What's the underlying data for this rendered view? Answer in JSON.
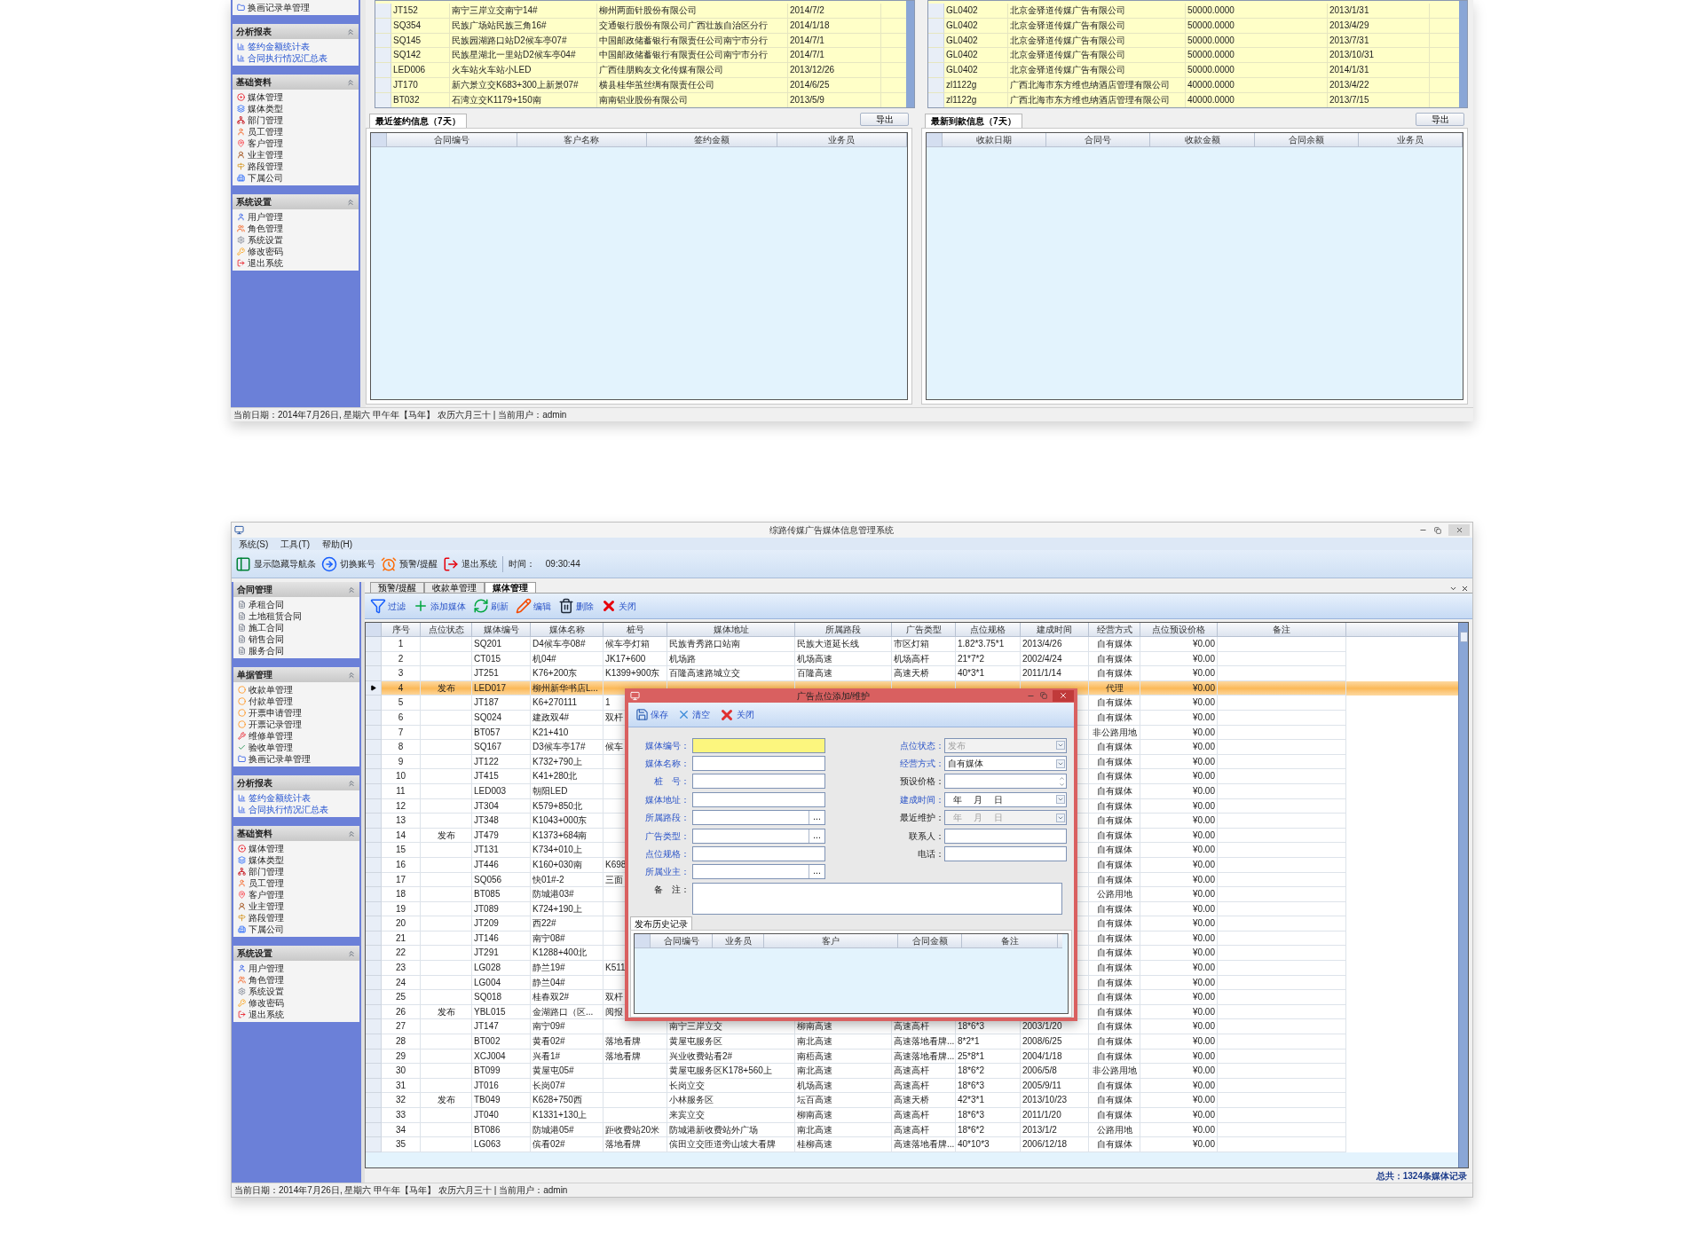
{
  "top_window": {
    "sidebar": [
      {
        "kind": "documents",
        "items": [
          {
            "label": "换画记录单管理"
          }
        ]
      },
      {
        "kind": "reports",
        "title": "分析报表",
        "items": [
          {
            "label": "签约金额统计表"
          },
          {
            "label": "合同执行情况汇总表"
          }
        ]
      },
      {
        "kind": "basics",
        "title": "基础资料",
        "items": [
          {
            "label": "媒体管理"
          },
          {
            "label": "媒体类型"
          },
          {
            "label": "部门管理"
          },
          {
            "label": "员工管理"
          },
          {
            "label": "客户管理"
          },
          {
            "label": "业主管理"
          },
          {
            "label": "路段管理"
          },
          {
            "label": "下属公司"
          }
        ]
      },
      {
        "kind": "settings",
        "title": "系统设置",
        "items": [
          {
            "label": "用户管理"
          },
          {
            "label": "角色管理"
          },
          {
            "label": "系统设置"
          },
          {
            "label": "修改密码"
          },
          {
            "label": "退出系统"
          }
        ]
      }
    ],
    "signed_list": {
      "rows": [
        [
          "JT152",
          "南宁三岸立交南宁14#",
          "柳州两面针股份有限公司",
          "2014/7/2"
        ],
        [
          "SQ354",
          "民族广场站民族三角16#",
          "交通银行股份有限公司广西壮族自治区分行",
          "2014/1/18"
        ],
        [
          "SQ145",
          "民族园湖路口站D2候车亭07#",
          "中国邮政储蓄银行有限责任公司南宁市分行",
          "2014/7/1"
        ],
        [
          "SQ142",
          "民族星湖北一里站D2候车亭04#",
          "中国邮政储蓄银行有限责任公司南宁市分行",
          "2014/7/1"
        ],
        [
          "LED006",
          "火车站火车站小LED",
          "广西佳朋购友文化传媒有限公司",
          "2013/12/26"
        ],
        [
          "JT170",
          "新六景立交K683+300上新景07#",
          "横县桂华茧丝绸有限责任公司",
          "2014/6/25"
        ],
        [
          "BT032",
          "石湾立交K1179+150南",
          "南南铝业股份有限公司",
          "2013/5/9"
        ]
      ]
    },
    "payment_list": {
      "rows": [
        [
          "GL0402",
          "北京金驿道传媒广告有限公司",
          "50000.0000",
          "2013/1/31"
        ],
        [
          "GL0402",
          "北京金驿道传媒广告有限公司",
          "50000.0000",
          "2013/4/29"
        ],
        [
          "GL0402",
          "北京金驿道传媒广告有限公司",
          "50000.0000",
          "2013/7/31"
        ],
        [
          "GL0402",
          "北京金驿道传媒广告有限公司",
          "50000.0000",
          "2013/10/31"
        ],
        [
          "GL0402",
          "北京金驿道传媒广告有限公司",
          "50000.0000",
          "2014/1/31"
        ],
        [
          "zl1122g",
          "广西北海市东方维也纳酒店管理有限公司",
          "40000.0000",
          "2013/4/22"
        ],
        [
          "zl1122g",
          "广西北海市东方维也纳酒店管理有限公司",
          "40000.0000",
          "2013/7/15"
        ]
      ]
    },
    "panels": [
      {
        "tab": "最近签约信息（7天）",
        "export": "导出",
        "columns": [
          "合同编号",
          "客户名称",
          "签约金额",
          "业务员"
        ]
      },
      {
        "tab": "最新到款信息（7天）",
        "export": "导出",
        "columns": [
          "收款日期",
          "合同号",
          "收款金额",
          "合同余额",
          "业务员"
        ]
      }
    ],
    "status_bar": "当前日期：2014年7月26日, 星期六 甲午年【马年】 农历六月三十 | 当前用户：admin"
  },
  "bottom_window": {
    "title": "综路传媒广告媒体信息管理系统",
    "menu": [
      "系统(S)",
      "工具(T)",
      "帮助(H)"
    ],
    "toolbar": [
      {
        "kind": "nav",
        "label": "显示隐藏导航条"
      },
      {
        "kind": "switch",
        "label": "切换账号"
      },
      {
        "kind": "alarm",
        "label": "预警/提醒"
      },
      {
        "kind": "exit",
        "label": "退出系统"
      }
    ],
    "time_label": "时间：",
    "time": "09:30:44",
    "sidebar": [
      {
        "kind": "contracts",
        "title": "合同管理",
        "items": [
          {
            "label": "承租合同"
          },
          {
            "label": "土地租赁合同"
          },
          {
            "label": "施工合同"
          },
          {
            "label": "销售合同"
          },
          {
            "label": "服务合同"
          }
        ]
      },
      {
        "kind": "documents",
        "title": "单据管理",
        "items": [
          {
            "label": "收款单管理"
          },
          {
            "label": "付款单管理"
          },
          {
            "label": "开票申请管理"
          },
          {
            "label": "开票记录管理"
          },
          {
            "label": "维修单管理"
          },
          {
            "label": "验收单管理"
          },
          {
            "label": "换画记录单管理"
          }
        ]
      },
      {
        "kind": "reports",
        "title": "分析报表",
        "items": [
          {
            "label": "签约金额统计表"
          },
          {
            "label": "合同执行情况汇总表"
          }
        ]
      },
      {
        "kind": "basics",
        "title": "基础资料",
        "items": [
          {
            "label": "媒体管理"
          },
          {
            "label": "媒体类型"
          },
          {
            "label": "部门管理"
          },
          {
            "label": "员工管理"
          },
          {
            "label": "客户管理"
          },
          {
            "label": "业主管理"
          },
          {
            "label": "路段管理"
          },
          {
            "label": "下属公司"
          }
        ]
      },
      {
        "kind": "settings",
        "title": "系统设置",
        "items": [
          {
            "label": "用户管理"
          },
          {
            "label": "角色管理"
          },
          {
            "label": "系统设置"
          },
          {
            "label": "修改密码"
          },
          {
            "label": "退出系统"
          }
        ]
      }
    ],
    "tabs": [
      {
        "label": "预警/提醒",
        "selected": false
      },
      {
        "label": "收款单管理",
        "selected": false
      },
      {
        "label": "媒体管理",
        "selected": true
      }
    ],
    "actions": [
      {
        "kind": "filter",
        "label": "过滤"
      },
      {
        "kind": "add",
        "label": "添加媒体"
      },
      {
        "kind": "refresh",
        "label": "刷新"
      },
      {
        "kind": "edit",
        "label": "编辑"
      },
      {
        "kind": "delete",
        "label": "删除"
      },
      {
        "kind": "close",
        "label": "关闭"
      }
    ],
    "table": {
      "columns": [
        "序号",
        "点位状态",
        "媒体编号",
        "媒体名称",
        "桩号",
        "媒体地址",
        "所属路段",
        "广告类型",
        "点位规格",
        "建成时间",
        "经营方式",
        "点位预设价格",
        "备注"
      ],
      "rows": [
        {
          "selected": false,
          "cells": [
            "1",
            null,
            "SQ201",
            "D4候车亭08#",
            "候车亭灯箱",
            "民族青秀路口站南",
            "民族大道延长线",
            "市区灯箱",
            "1.82*3.75*1",
            "2013/4/26",
            "自有媒体",
            "¥0.00"
          ]
        },
        {
          "selected": false,
          "cells": [
            "2",
            null,
            "CT015",
            "机04#",
            "JK17+600",
            "机场路",
            "机场高速",
            "机场高杆",
            "21*7*2",
            "2002/4/24",
            "自有媒体",
            "¥0.00"
          ]
        },
        {
          "selected": false,
          "cells": [
            "3",
            null,
            "JT251",
            "K76+200东",
            "K1399+900东",
            "百隆高速路城立交",
            "百隆高速",
            "高速天桥",
            "40*3*1",
            "2011/1/14",
            "自有媒体",
            "¥0.00"
          ]
        },
        {
          "selected": true,
          "cells": [
            "4",
            "发布",
            "LED017",
            "柳州新华书店L...",
            null,
            null,
            null,
            null,
            null,
            null,
            "代理",
            "¥0.00"
          ]
        },
        {
          "selected": false,
          "cells": [
            "5",
            null,
            "JT187",
            "K6+270111",
            "1",
            null,
            null,
            null,
            null,
            null,
            "自有媒体",
            "¥0.00"
          ]
        },
        {
          "selected": false,
          "cells": [
            "6",
            null,
            "SQ024",
            "建政双4#",
            "双杆",
            null,
            null,
            null,
            null,
            null,
            "自有媒体",
            "¥0.00"
          ]
        },
        {
          "selected": false,
          "cells": [
            "7",
            null,
            "BT057",
            "K21+410",
            null,
            null,
            null,
            null,
            null,
            null,
            "非公路用地",
            "¥0.00"
          ]
        },
        {
          "selected": false,
          "cells": [
            "8",
            null,
            "SQ167",
            "D3候车亭17#",
            "候车",
            null,
            null,
            null,
            null,
            null,
            "自有媒体",
            "¥0.00"
          ]
        },
        {
          "selected": false,
          "cells": [
            "9",
            null,
            "JT122",
            "K732+790上",
            null,
            null,
            null,
            null,
            null,
            null,
            "自有媒体",
            "¥0.00"
          ]
        },
        {
          "selected": false,
          "cells": [
            "10",
            null,
            "JT415",
            "K41+280北",
            null,
            null,
            null,
            null,
            null,
            null,
            "自有媒体",
            "¥0.00"
          ]
        },
        {
          "selected": false,
          "cells": [
            "11",
            null,
            "LED003",
            "朝阳LED",
            null,
            null,
            null,
            null,
            null,
            null,
            "自有媒体",
            "¥0.00"
          ]
        },
        {
          "selected": false,
          "cells": [
            "12",
            null,
            "JT304",
            "K579+850北",
            null,
            null,
            null,
            null,
            null,
            null,
            "自有媒体",
            "¥0.00"
          ]
        },
        {
          "selected": false,
          "cells": [
            "13",
            null,
            "JT348",
            "K1043+000东",
            null,
            null,
            null,
            null,
            null,
            null,
            "自有媒体",
            "¥0.00"
          ]
        },
        {
          "selected": false,
          "cells": [
            "14",
            "发布",
            "JT479",
            "K1373+684南",
            null,
            null,
            null,
            null,
            null,
            null,
            "自有媒体",
            "¥0.00"
          ]
        },
        {
          "selected": false,
          "cells": [
            "15",
            null,
            "JT131",
            "K734+010上",
            null,
            null,
            null,
            null,
            null,
            null,
            "自有媒体",
            "¥0.00"
          ]
        },
        {
          "selected": false,
          "cells": [
            "16",
            null,
            "JT446",
            "K160+030南",
            "K698",
            null,
            null,
            null,
            null,
            null,
            "自有媒体",
            "¥0.00"
          ]
        },
        {
          "selected": false,
          "cells": [
            "17",
            null,
            "SQ056",
            "快01#-2",
            "三面",
            null,
            null,
            null,
            null,
            null,
            "自有媒体",
            "¥0.00"
          ]
        },
        {
          "selected": false,
          "cells": [
            "18",
            null,
            "BT085",
            "防城港03#",
            null,
            null,
            null,
            null,
            null,
            null,
            "公路用地",
            "¥0.00"
          ]
        },
        {
          "selected": false,
          "cells": [
            "19",
            null,
            "JT089",
            "K724+190上",
            null,
            null,
            null,
            null,
            null,
            null,
            "自有媒体",
            "¥0.00"
          ]
        },
        {
          "selected": false,
          "cells": [
            "20",
            null,
            "JT209",
            "西22#",
            null,
            null,
            null,
            null,
            null,
            null,
            "自有媒体",
            "¥0.00"
          ]
        },
        {
          "selected": false,
          "cells": [
            "21",
            null,
            "JT146",
            "南宁08#",
            null,
            null,
            null,
            null,
            null,
            null,
            "自有媒体",
            "¥0.00"
          ]
        },
        {
          "selected": false,
          "cells": [
            "22",
            null,
            "JT291",
            "K1288+400北",
            null,
            null,
            null,
            null,
            null,
            null,
            "自有媒体",
            "¥0.00"
          ]
        },
        {
          "selected": false,
          "cells": [
            "23",
            null,
            "LG028",
            "静兰19#",
            "K511",
            null,
            null,
            null,
            null,
            null,
            "自有媒体",
            "¥0.00"
          ]
        },
        {
          "selected": false,
          "cells": [
            "24",
            null,
            "LG004",
            "静兰04#",
            null,
            null,
            null,
            null,
            null,
            null,
            "自有媒体",
            "¥0.00"
          ]
        },
        {
          "selected": false,
          "cells": [
            "25",
            null,
            "SQ018",
            "桂春双2#",
            "双杆",
            null,
            null,
            null,
            null,
            null,
            "自有媒体",
            "¥0.00"
          ]
        },
        {
          "selected": false,
          "cells": [
            "26",
            "发布",
            "YBL015",
            "金湖路口（区...",
            "阅报",
            null,
            null,
            null,
            null,
            null,
            "自有媒体",
            "¥0.00"
          ]
        },
        {
          "selected": false,
          "cells": [
            "27",
            null,
            "JT147",
            "南宁09#",
            null,
            "南宁三岸立交",
            "柳南高速",
            "高速高杆",
            "18*6*3",
            "2003/1/20",
            "自有媒体",
            "¥0.00"
          ]
        },
        {
          "selected": false,
          "cells": [
            "28",
            null,
            "BT002",
            "黄看02#",
            "落地看牌",
            "黄屋屯服务区",
            "南北高速",
            "高速落地看牌...",
            "8*2*1",
            "2008/6/25",
            "自有媒体",
            "¥0.00"
          ]
        },
        {
          "selected": false,
          "cells": [
            "29",
            null,
            "XCJ004",
            "兴看1#",
            "落地看牌",
            "兴业收费站看2#",
            "南梧高速",
            "高速落地看牌...",
            "25*8*1",
            "2004/1/18",
            "自有媒体",
            "¥0.00"
          ]
        },
        {
          "selected": false,
          "cells": [
            "30",
            null,
            "BT099",
            "黄屋屯05#",
            null,
            "黄屋屯服务区K178+560上",
            "南北高速",
            "高速高杆",
            "18*6*2",
            "2006/5/8",
            "非公路用地",
            "¥0.00"
          ]
        },
        {
          "selected": false,
          "cells": [
            "31",
            null,
            "JT016",
            "长岗07#",
            null,
            "长岗立交",
            "机场高速",
            "高速高杆",
            "18*6*3",
            "2005/9/11",
            "自有媒体",
            "¥0.00"
          ]
        },
        {
          "selected": false,
          "cells": [
            "32",
            "发布",
            "TB049",
            "K628+750西",
            null,
            "小林服务区",
            "坛百高速",
            "高速天桥",
            "42*3*1",
            "2013/10/23",
            "自有媒体",
            "¥0.00"
          ]
        },
        {
          "selected": false,
          "cells": [
            "33",
            null,
            "JT040",
            "K1331+130上",
            null,
            "来宾立交",
            "柳南高速",
            "高速高杆",
            "18*6*3",
            "2011/1/20",
            "自有媒体",
            "¥0.00"
          ]
        },
        {
          "selected": false,
          "cells": [
            "34",
            null,
            "BT086",
            "防城港05#",
            "距收费站20米",
            "防城港新收费站外广场",
            "南北高速",
            "高速高杆",
            "18*6*2",
            "2013/1/2",
            "公路用地",
            "¥0.00"
          ]
        },
        {
          "selected": false,
          "cells": [
            "35",
            null,
            "LG063",
            "傧看02#",
            "落地看牌",
            "傧田立交匝道旁山坡大看牌",
            "桂柳高速",
            "高速落地看牌...",
            "40*10*3",
            "2006/12/18",
            "自有媒体",
            "¥0.00"
          ]
        }
      ]
    },
    "total": "总共：1324条媒体记录",
    "status_bar": "当前日期：2014年7月26日, 星期六 甲午年【马年】 农历六月三十 | 当前用户：admin",
    "dialog": {
      "title": "广告点位添加/维护",
      "buttons": [
        {
          "kind": "save",
          "label": "保存"
        },
        {
          "kind": "clear",
          "label": "清空"
        },
        {
          "kind": "close",
          "label": "关闭"
        }
      ],
      "left_fields": [
        {
          "label": "媒体编号：",
          "kind": "text",
          "required": true,
          "highlighted": true
        },
        {
          "label": "媒体名称：",
          "kind": "text",
          "required": true,
          "highlighted": false
        },
        {
          "label": "桩　号：",
          "kind": "text",
          "required": true,
          "highlighted": false
        },
        {
          "label": "媒体地址：",
          "kind": "text",
          "required": true,
          "highlighted": false
        },
        {
          "label": "所属路段：",
          "kind": "browse",
          "required": true,
          "highlighted": false,
          "button": "..."
        },
        {
          "label": "广告类型：",
          "kind": "browse",
          "required": true,
          "highlighted": false,
          "button": "..."
        },
        {
          "label": "点位规格：",
          "kind": "text",
          "required": true,
          "highlighted": false
        },
        {
          "label": "所属业主：",
          "kind": "browse",
          "required": true,
          "highlighted": false,
          "button": "..."
        }
      ],
      "right_fields": [
        {
          "label": "点位状态：",
          "kind": "combo",
          "required": true,
          "disabled": true,
          "value": "发布"
        },
        {
          "label": "经营方式：",
          "kind": "combo",
          "required": true,
          "disabled": false,
          "value": "自有媒体"
        },
        {
          "label": "预设价格：",
          "kind": "spin",
          "required": false,
          "disabled": false
        },
        {
          "label": "建成时间：",
          "kind": "date",
          "required": true,
          "disabled": false,
          "value": "年 月 日"
        },
        {
          "label": "最近维护：",
          "kind": "date",
          "required": false,
          "disabled": true,
          "value": "年 月 日"
        },
        {
          "label": "联系人：",
          "kind": "text",
          "required": false,
          "disabled": false
        },
        {
          "label": "电话：",
          "kind": "text",
          "required": false,
          "disabled": false
        }
      ],
      "note_label": "备　注：",
      "history_tab": "发布历史记录",
      "history_columns": [
        "合同编号",
        "业务员",
        "客户",
        "合同金额",
        "备注"
      ]
    }
  }
}
